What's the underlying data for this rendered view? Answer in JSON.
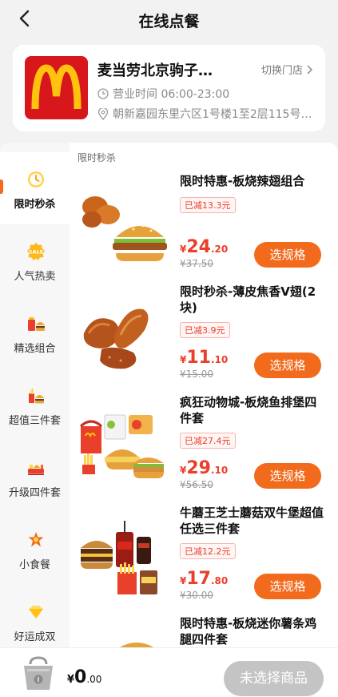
{
  "header": {
    "title": "在线点餐"
  },
  "store": {
    "name": "麦当劳北京驹子…",
    "switch_label": "切换门店",
    "hours": "营业时间 06:00-23:00",
    "address": "朝新嘉园东里六区1号楼1至2层115号…"
  },
  "sidebar": {
    "items": [
      {
        "label": "限时秒杀",
        "icon": "clock-icon",
        "active": true
      },
      {
        "label": "人气热卖",
        "icon": "sale-badge-icon"
      },
      {
        "label": "精选组合",
        "icon": "combo-icon"
      },
      {
        "label": "超值三件套",
        "icon": "three-piece-icon"
      },
      {
        "label": "升级四件套",
        "icon": "four-piece-icon"
      },
      {
        "label": "小食餐",
        "icon": "snack-icon"
      },
      {
        "label": "好运成双",
        "icon": "double-icon"
      }
    ]
  },
  "section": {
    "title": "限时秒杀"
  },
  "products": [
    {
      "name": "限时特惠-板烧辣翅组合",
      "discount": "已减13.3元",
      "currency": "¥",
      "price_int": "24",
      "price_dec": ".20",
      "old_price": "¥37.50",
      "button": "选规格"
    },
    {
      "name": "限时秒杀-薄皮焦香V翅(2块)",
      "discount": "已减3.9元",
      "currency": "¥",
      "price_int": "11",
      "price_dec": ".10",
      "old_price": "¥15.00",
      "button": "选规格"
    },
    {
      "name": "疯狂动物城-板烧鱼排堡四件套",
      "discount": "已减27.4元",
      "currency": "¥",
      "price_int": "29",
      "price_dec": ".10",
      "old_price": "¥56.50",
      "button": "选规格"
    },
    {
      "name": "牛蘑王芝士蘑菇双牛堡超值任选三件套",
      "discount": "已减12.2元",
      "currency": "¥",
      "price_int": "17",
      "price_dec": ".80",
      "old_price": "¥30.00",
      "button": "选规格"
    },
    {
      "name": "限时特惠-板烧迷你薯条鸡腿四件套"
    }
  ],
  "cart": {
    "currency": "¥",
    "total_int": "0",
    "total_dec": ".00",
    "checkout_label": "未选择商品"
  },
  "colors": {
    "accent": "#f26b1d",
    "price": "#e8402a",
    "brand_red": "#d8171c",
    "brand_yellow": "#ffc20e",
    "disabled": "#c4c4c4"
  }
}
